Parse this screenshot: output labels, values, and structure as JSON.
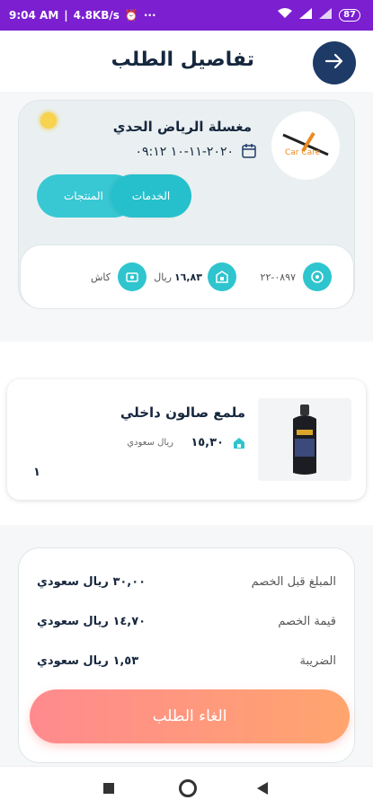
{
  "status": {
    "time": "9:04 AM",
    "speed": "4.8KB/s",
    "battery": "87"
  },
  "header": {
    "title": "تفاصيل الطلب"
  },
  "order": {
    "shop_name": "مغسلة الرياض الحدي",
    "date": "٢٠٢٠-١١-١٠  ٠٩:١٢",
    "logo_text": "Car Care",
    "tabs": {
      "products": "المنتجات",
      "services": "الخدمات"
    },
    "info": {
      "order_no": "٠٨٩٧-٢٢",
      "amount": "١٦,٨٣",
      "currency": "ريال",
      "payment": "كاش"
    }
  },
  "product": {
    "name": "ملمع صالون داخلي",
    "price": "١٥,٣٠",
    "currency": "ريال سعودي",
    "qty": "١"
  },
  "summary": {
    "rows": [
      {
        "label": "المبلغ قبل الخصم",
        "value": "٣٠,٠٠  ريال سعودي"
      },
      {
        "label": "قيمة الخصم",
        "value": "١٤,٧٠  ريال سعودي"
      },
      {
        "label": "الضريبة",
        "value": "١,٥٣  ريال سعودي"
      }
    ]
  },
  "actions": {
    "cancel": "الغاء الطلب"
  },
  "icons": [
    "arrow-right-icon",
    "calendar-icon",
    "sun-icon",
    "receipt-icon",
    "money-icon",
    "cash-icon",
    "price-tag-icon"
  ]
}
